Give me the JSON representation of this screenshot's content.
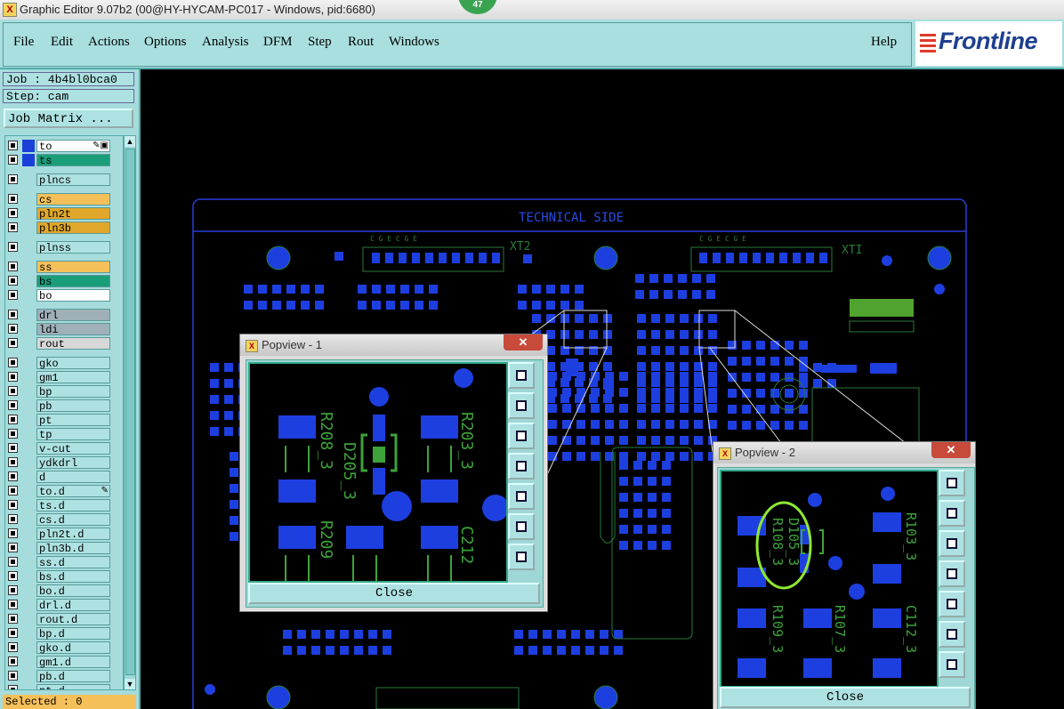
{
  "window": {
    "title": "Graphic Editor 9.07b2 (00@HY-HYCAM-PC017 - Windows, pid:6680)",
    "badge": "47"
  },
  "menu": {
    "items": [
      "File",
      "Edit",
      "Actions",
      "Options",
      "Analysis",
      "DFM",
      "Step",
      "Rout",
      "Windows"
    ],
    "help": "Help",
    "brand": "Frontline"
  },
  "job": {
    "label": "Job : 4b4bl0bca0",
    "step": "Step: cam",
    "matrix_button": "Job Matrix ..."
  },
  "layers": [
    {
      "name": "to",
      "color": "#ffffff",
      "swatch": "#1a3fd9",
      "swatch2": "#1e9e3a",
      "icon": "✎▣"
    },
    {
      "name": "ts",
      "color": "#1a9e7a",
      "swatch": "#1a3fd9",
      "swatch2": "#1a3fd9"
    },
    {
      "name": "plncs",
      "color": "#aee2e2"
    },
    {
      "name": "cs",
      "color": "#f5c05a"
    },
    {
      "name": "pln2t",
      "color": "#e0a72a"
    },
    {
      "name": "pln3b",
      "color": "#e0a72a"
    },
    {
      "name": "plnss",
      "color": "#aee2e2"
    },
    {
      "name": "ss",
      "color": "#f5c05a"
    },
    {
      "name": "bs",
      "color": "#1a9e7a"
    },
    {
      "name": "bo",
      "color": "#ffffff"
    },
    {
      "name": "drl",
      "color": "#9fb0b8"
    },
    {
      "name": "ldi",
      "color": "#9fb0b8"
    },
    {
      "name": "rout",
      "color": "#d8d8d8"
    },
    {
      "name": "gko",
      "color": "#aee2e2"
    },
    {
      "name": "gm1",
      "color": "#aee2e2"
    },
    {
      "name": "bp",
      "color": "#aee2e2"
    },
    {
      "name": "pb",
      "color": "#aee2e2"
    },
    {
      "name": "pt",
      "color": "#aee2e2"
    },
    {
      "name": "tp",
      "color": "#aee2e2"
    },
    {
      "name": "v-cut",
      "color": "#aee2e2"
    },
    {
      "name": "ydkdrl",
      "color": "#aee2e2"
    },
    {
      "name": "d",
      "color": "#aee2e2"
    },
    {
      "name": "to.d",
      "color": "#aee2e2",
      "icon": "✎"
    },
    {
      "name": "ts.d",
      "color": "#aee2e2"
    },
    {
      "name": "cs.d",
      "color": "#aee2e2"
    },
    {
      "name": "pln2t.d",
      "color": "#aee2e2"
    },
    {
      "name": "pln3b.d",
      "color": "#aee2e2"
    },
    {
      "name": "ss.d",
      "color": "#aee2e2"
    },
    {
      "name": "bs.d",
      "color": "#aee2e2"
    },
    {
      "name": "bo.d",
      "color": "#aee2e2"
    },
    {
      "name": "drl.d",
      "color": "#aee2e2"
    },
    {
      "name": "rout.d",
      "color": "#aee2e2"
    },
    {
      "name": "bp.d",
      "color": "#aee2e2"
    },
    {
      "name": "gko.d",
      "color": "#aee2e2"
    },
    {
      "name": "gm1.d",
      "color": "#aee2e2"
    },
    {
      "name": "pb.d",
      "color": "#aee2e2"
    },
    {
      "name": "pt.d",
      "color": "#aee2e2"
    }
  ],
  "status": {
    "selected": "Selected : 0"
  },
  "board": {
    "side_label": "TECHNICAL  SIDE",
    "xt2": "XT2",
    "xt1": "XTI",
    "connector_pins": "C  G E C  G E"
  },
  "popview1": {
    "title": "Popview - 1",
    "close": "Close",
    "labels": [
      "R208_3",
      "D205_3",
      "R203_3",
      "R209",
      "C212"
    ]
  },
  "popview2": {
    "title": "Popview - 2",
    "close": "Close",
    "labels": [
      "R108_3",
      "D105_3",
      "R103_3",
      "R109_3",
      "R107_3",
      "C112_3"
    ]
  }
}
